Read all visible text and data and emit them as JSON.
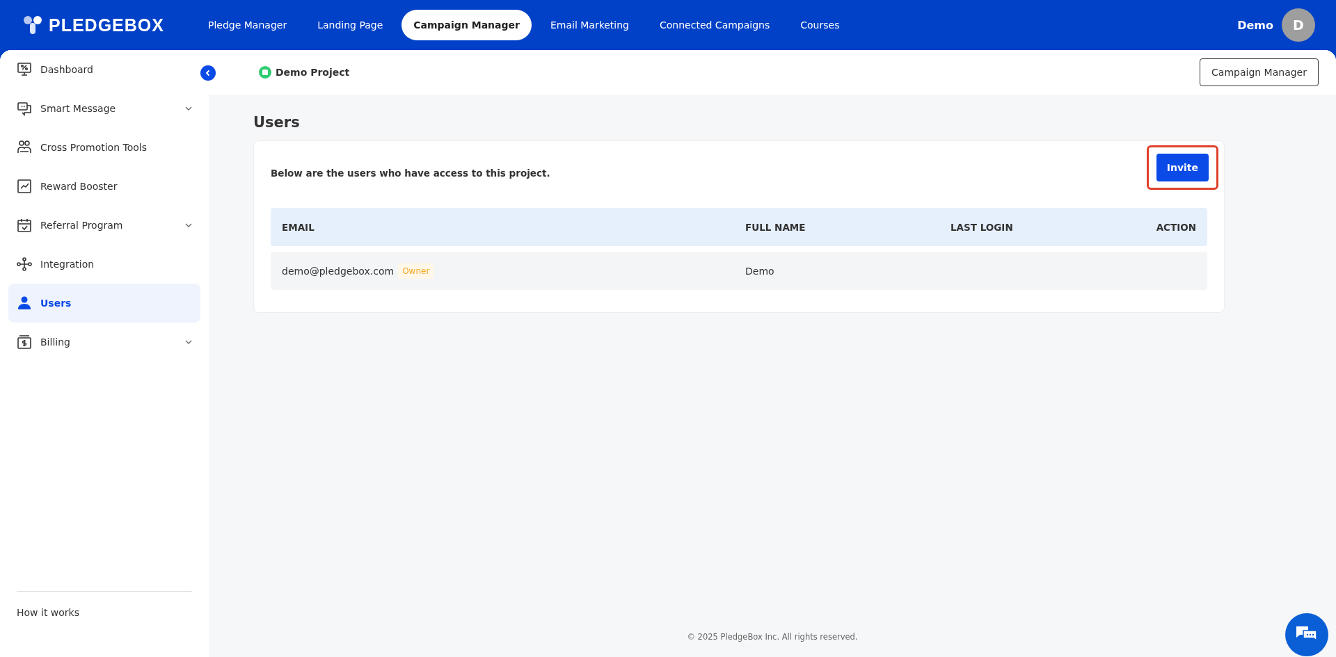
{
  "brand": {
    "name": "PLEDGEBOX"
  },
  "top_nav": [
    {
      "label": "Pledge Manager",
      "selected": false
    },
    {
      "label": "Landing Page",
      "selected": false
    },
    {
      "label": "Campaign Manager",
      "selected": true
    },
    {
      "label": "Email Marketing",
      "selected": false
    },
    {
      "label": "Connected Campaigns",
      "selected": false
    },
    {
      "label": "Courses",
      "selected": false
    }
  ],
  "user": {
    "name": "Demo",
    "initial": "D"
  },
  "sidebar": {
    "items": [
      {
        "label": "Dashboard",
        "has_submenu": false,
        "selected": false
      },
      {
        "label": "Smart Message",
        "has_submenu": true,
        "selected": false
      },
      {
        "label": "Cross Promotion Tools",
        "has_submenu": false,
        "selected": false
      },
      {
        "label": "Reward Booster",
        "has_submenu": false,
        "selected": false
      },
      {
        "label": "Referral Program",
        "has_submenu": true,
        "selected": false
      },
      {
        "label": "Integration",
        "has_submenu": false,
        "selected": false
      },
      {
        "label": "Users",
        "has_submenu": false,
        "selected": true
      },
      {
        "label": "Billing",
        "has_submenu": true,
        "selected": false
      }
    ],
    "footer_link": "How it works"
  },
  "project": {
    "name": "Demo Project",
    "button": "Campaign Manager"
  },
  "page_title": "Users",
  "card": {
    "description": "Below are the users who have access to this project.",
    "invite_button": "Invite",
    "table": {
      "columns": [
        "EMAIL",
        "FULL NAME",
        "LAST LOGIN",
        "ACTION"
      ],
      "rows": [
        {
          "email": "demo@pledgebox.com",
          "badge": "Owner",
          "full_name": "Demo"
        }
      ]
    }
  },
  "footer": "© 2025 PledgeBox Inc. All rights reserved."
}
